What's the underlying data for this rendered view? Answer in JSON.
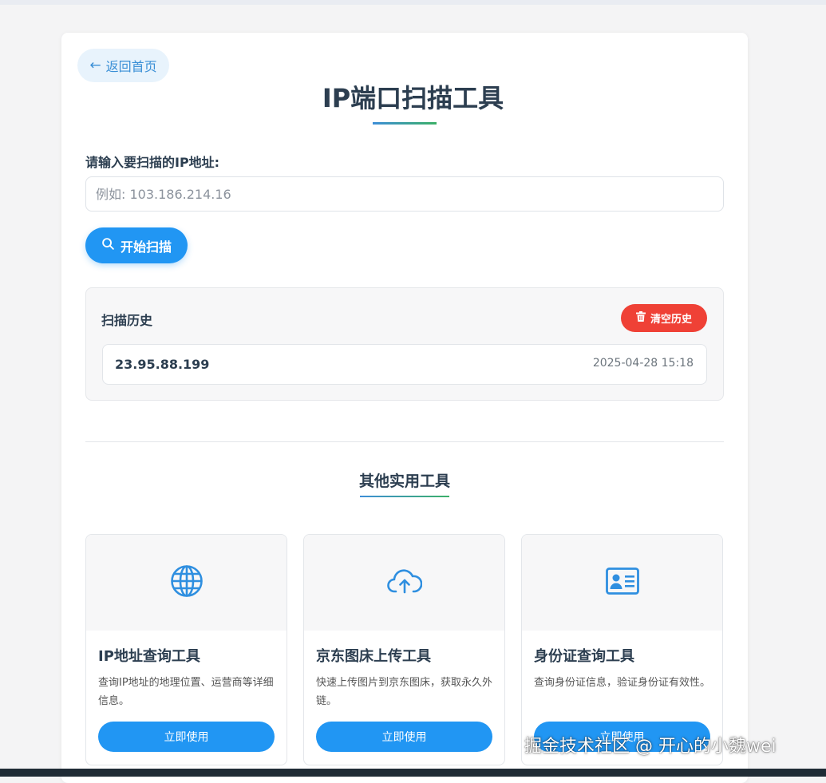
{
  "header": {
    "back_label": "返回首页",
    "title": "IP端口扫描工具"
  },
  "scan_form": {
    "label": "请输入要扫描的IP地址:",
    "value": "",
    "placeholder": "例如: 103.186.214.16",
    "button_label": "开始扫描"
  },
  "history": {
    "title": "扫描历史",
    "clear_label": "清空历史",
    "items": [
      {
        "ip": "23.95.88.199",
        "time": "2025-04-28 15:18"
      }
    ]
  },
  "other_tools": {
    "title": "其他实用工具",
    "tools": [
      {
        "icon": "globe-icon",
        "name": "IP地址查询工具",
        "desc": "查询IP地址的地理位置、运营商等详细信息。",
        "button": "立即使用"
      },
      {
        "icon": "cloud-upload-icon",
        "name": "京东图床上传工具",
        "desc": "快速上传图片到京东图床，获取永久外链。",
        "button": "立即使用"
      },
      {
        "icon": "id-card-icon",
        "name": "身份证查询工具",
        "desc": "查询身份证信息，验证身份证有效性。",
        "button": "立即使用"
      }
    ]
  },
  "watermark": "掘金技术社区 @ 开心的小魏wei",
  "colors": {
    "primary": "#2196f3",
    "danger": "#ef4136",
    "accent_green": "#3cb067",
    "text": "#2c3e50"
  }
}
